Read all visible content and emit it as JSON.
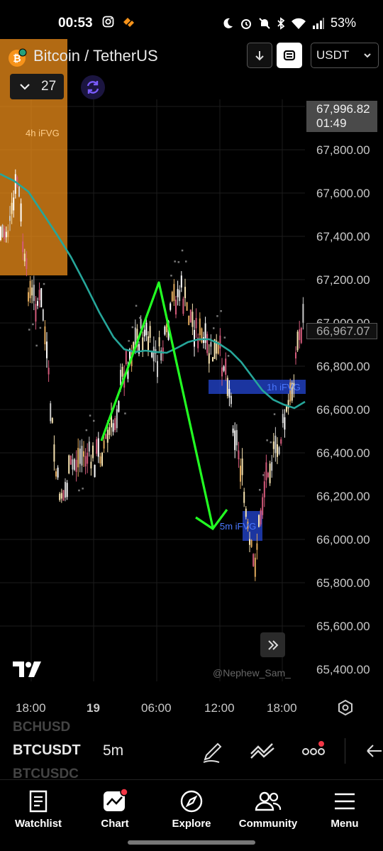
{
  "status_bar": {
    "time": "00:53",
    "battery": "53%"
  },
  "header": {
    "symbol_title": "Bitcoin / TetherUS",
    "currency": "USDT",
    "collapse_count": "27"
  },
  "chart_data": {
    "type": "candlestick",
    "price_axis": [
      "67,800.00",
      "67,600.00",
      "67,400.00",
      "67,200.00",
      "67,000.00",
      "66,800.00",
      "66,600.00",
      "66,400.00",
      "66,200.00",
      "66,000.00",
      "65,800.00",
      "65,600.00",
      "65,400.00"
    ],
    "time_axis": [
      "18:00",
      "19",
      "06:00",
      "12:00",
      "18:00"
    ],
    "current_price": "67,996.82",
    "countdown": "01:49",
    "last_price_marker": "66,967.07",
    "zones": [
      {
        "label": "4h iFVG",
        "color": "#f7931a"
      },
      {
        "label": "1h iFVG",
        "color": "#2a54ff"
      },
      {
        "label": "5m iFVG",
        "color": "#2a54ff"
      }
    ],
    "moving_average_color": "#26a69a",
    "drawing_color": "#22ff22",
    "watermark": "@Nephew_Sam_"
  },
  "toolbar": {
    "ticker_prev": "BCHUSD",
    "ticker_current": "BTCUSDT",
    "ticker_next": "BTCUSDC",
    "interval": "5m"
  },
  "nav": {
    "watchlist": "Watchlist",
    "chart": "Chart",
    "explore": "Explore",
    "community": "Community",
    "menu": "Menu"
  }
}
